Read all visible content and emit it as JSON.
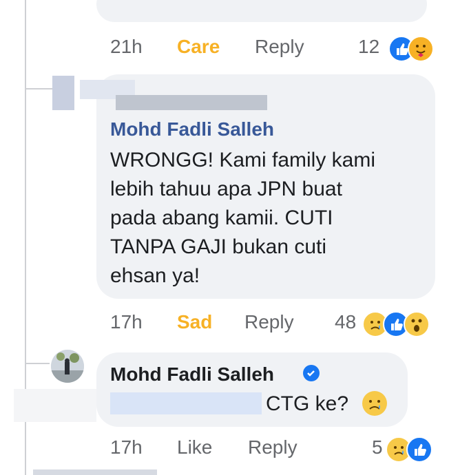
{
  "comment1": {
    "time": "21h",
    "reaction": "Care",
    "reply": "Reply",
    "count": "12",
    "icons": [
      "like-icon",
      "care-icon"
    ]
  },
  "comment2": {
    "name": "Mohd Fadli Salleh",
    "text": [
      "WRONGG! Kami family kami",
      "lebih tahuu apa JPN buat",
      "pada abang kamii. CUTI",
      "TANPA GAJI bukan cuti",
      "ehsan ya!"
    ],
    "time": "17h",
    "reaction": "Sad",
    "reply": "Reply",
    "count": "48",
    "icons": [
      "sad-icon",
      "like-icon",
      "wow-icon"
    ]
  },
  "comment3": {
    "name": "Mohd Fadli Salleh",
    "text": "CTG ke?",
    "emoji": "sad-face",
    "time": "17h",
    "reaction": "Like",
    "reply": "Reply",
    "count": "5",
    "icons": [
      "sad-icon",
      "like-icon"
    ]
  },
  "colors": {
    "bubble": "#f0f2f5",
    "like_blue": "#1877f2",
    "care_yellow": "#f7b125",
    "secondary_text": "#65676b",
    "name_link": "#385898"
  }
}
